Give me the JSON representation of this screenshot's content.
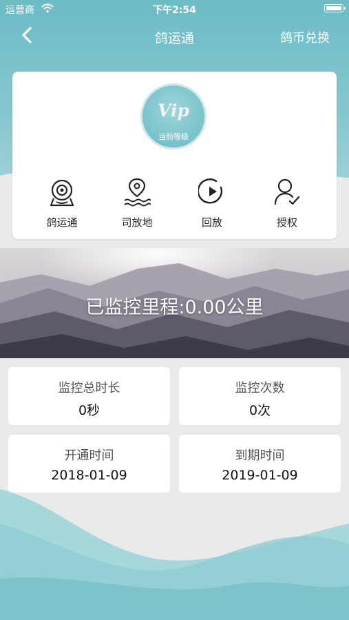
{
  "status_bar": {
    "carrier": "运营商",
    "time": "下午2:54"
  },
  "nav": {
    "title": "鸽运通",
    "right": "鸽币兑换"
  },
  "vip": {
    "badge": "Vip",
    "level_label": "当前等级"
  },
  "features": [
    {
      "label": "鸽运通",
      "icon": "camera-icon"
    },
    {
      "label": "司放地",
      "icon": "location-icon"
    },
    {
      "label": "回放",
      "icon": "play-icon"
    },
    {
      "label": "授权",
      "icon": "user-check-icon"
    }
  ],
  "banner": {
    "text": "已监控里程:0.00公里"
  },
  "stats": [
    {
      "label": "监控总时长",
      "value": "0秒"
    },
    {
      "label": "监控次数",
      "value": "0次"
    },
    {
      "label": "开通时间",
      "value": "2018-01-09"
    },
    {
      "label": "到期时间",
      "value": "2019-01-09"
    }
  ],
  "colors": {
    "accent": "#6cbcc6",
    "white": "#ffffff"
  }
}
